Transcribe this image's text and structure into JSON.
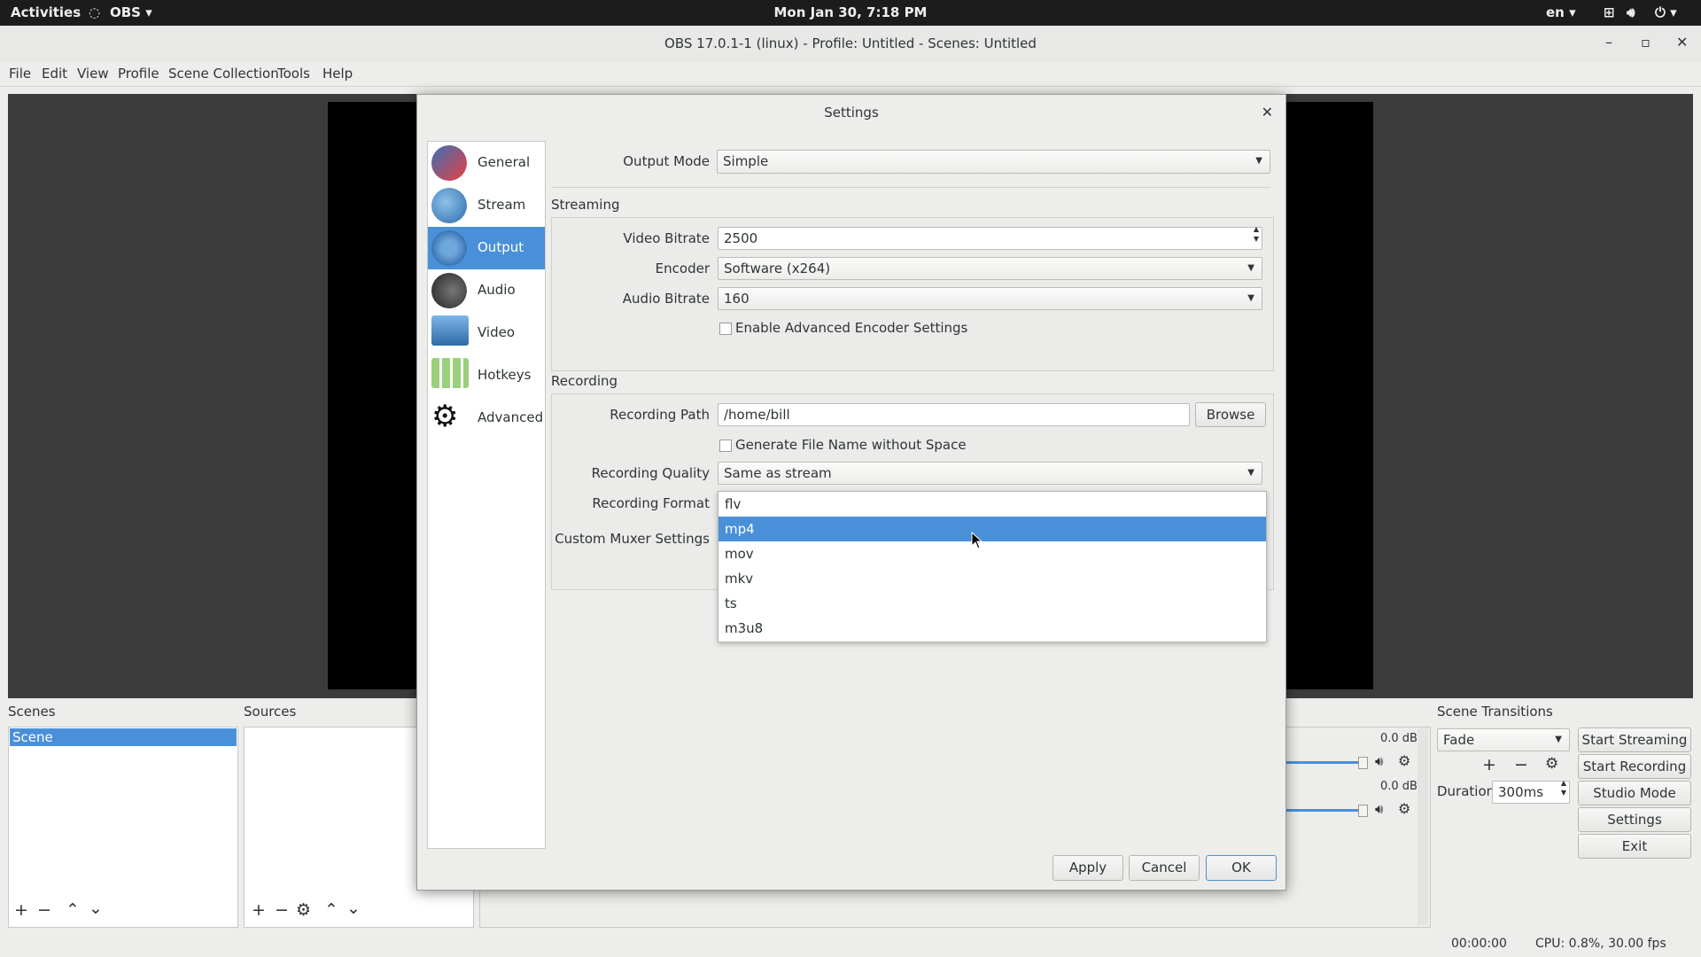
{
  "topbar": {
    "activities": "Activities",
    "app_menu": "OBS ▾",
    "clock": "Mon Jan 30,  7:18 PM",
    "lang": "en ▾"
  },
  "window": {
    "title": "OBS 17.0.1-1 (linux) - Profile: Untitled - Scenes: Untitled",
    "minimize": "–",
    "maximize": "▫",
    "close": "✕"
  },
  "menubar": [
    "File",
    "Edit",
    "View",
    "Profile",
    "Scene Collection",
    "Tools",
    "Help"
  ],
  "docks": {
    "scenes_title": "Scenes",
    "scenes": [
      "Scene"
    ],
    "sources_title": "Sources",
    "transitions_title": "Scene Transitions",
    "transition": "Fade",
    "duration_label": "Duration",
    "duration_value": "300ms",
    "mixer_db1": "0.0 dB",
    "mixer_db2": "0.0 dB"
  },
  "controls": {
    "start_streaming": "Start Streaming",
    "start_recording": "Start Recording",
    "studio_mode": "Studio Mode",
    "settings": "Settings",
    "exit": "Exit"
  },
  "status": {
    "time": "00:00:00",
    "cpu": "CPU: 0.8%, 30.00 fps"
  },
  "settings": {
    "title": "Settings",
    "close": "✕",
    "sidebar": [
      "General",
      "Stream",
      "Output",
      "Audio",
      "Video",
      "Hotkeys",
      "Advanced"
    ],
    "selected_index": 2,
    "output_mode_label": "Output Mode",
    "output_mode": "Simple",
    "streaming_section": "Streaming",
    "video_bitrate_label": "Video Bitrate",
    "video_bitrate": "2500",
    "encoder_label": "Encoder",
    "encoder": "Software (x264)",
    "audio_bitrate_label": "Audio Bitrate",
    "audio_bitrate": "160",
    "advanced_encoder": "Enable Advanced Encoder Settings",
    "recording_section": "Recording",
    "recording_path_label": "Recording Path",
    "recording_path": "/home/bill",
    "browse": "Browse",
    "gen_filename": "Generate File Name without Space",
    "recording_quality_label": "Recording Quality",
    "recording_quality": "Same as stream",
    "recording_format_label": "Recording Format",
    "custom_muxer_label": "Custom Muxer Settings",
    "format_options": [
      "flv",
      "mp4",
      "mov",
      "mkv",
      "ts",
      "m3u8"
    ],
    "format_highlight_index": 1,
    "apply": "Apply",
    "cancel": "Cancel",
    "ok": "OK"
  },
  "colors": {
    "accent": "#4a90d9",
    "topbar": "#1c1c1c",
    "preview": "#000000"
  }
}
